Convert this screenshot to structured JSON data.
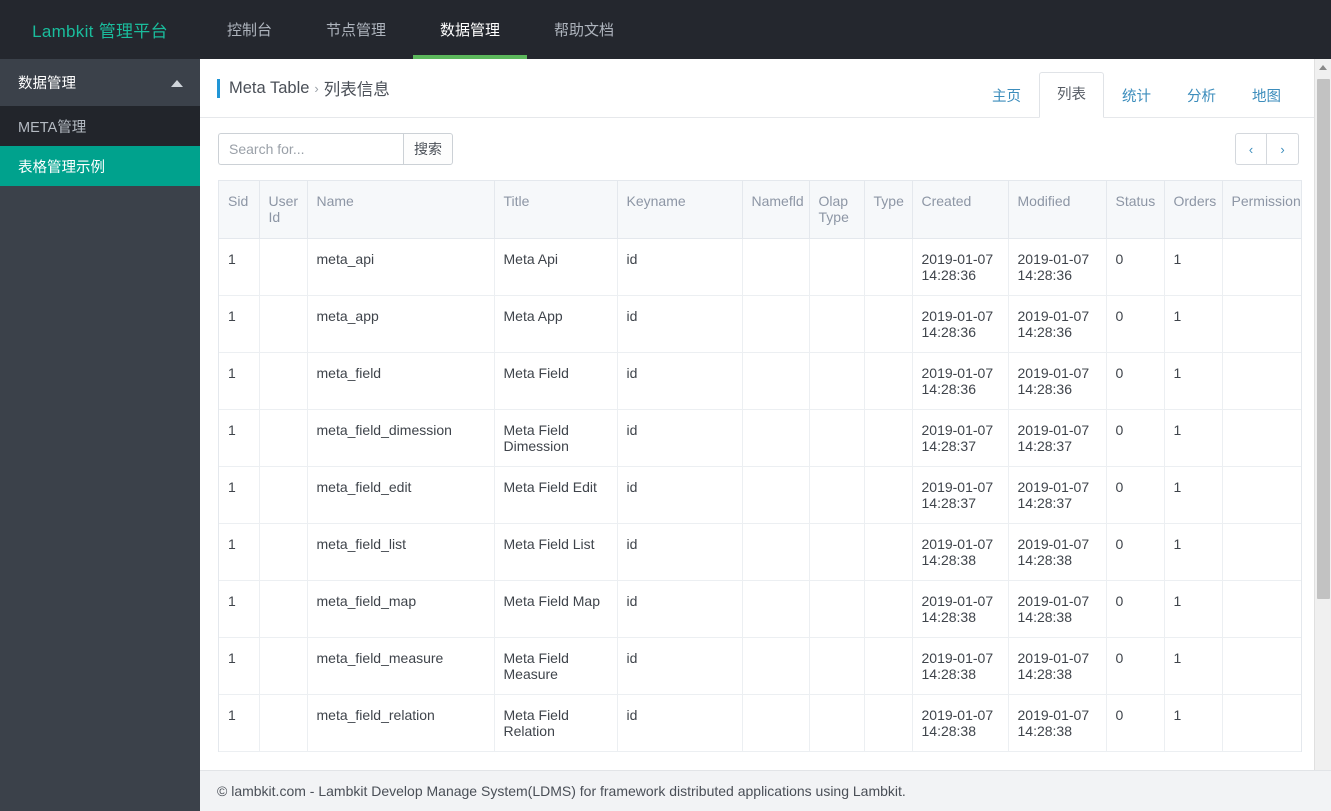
{
  "navbar": {
    "brand": "Lambkit 管理平台",
    "items": [
      {
        "label": "控制台",
        "active": false
      },
      {
        "label": "节点管理",
        "active": false
      },
      {
        "label": "数据管理",
        "active": true
      },
      {
        "label": "帮助文档",
        "active": false
      }
    ],
    "colors": {
      "background": "#24272e",
      "brand": "#1abc9c",
      "active_underline": "#5cb85c"
    }
  },
  "sidebar": {
    "header": "数据管理",
    "items": [
      {
        "label": "META管理",
        "active": false
      },
      {
        "label": "表格管理示例",
        "active": true
      }
    ],
    "colors": {
      "background": "#3b414a",
      "sub_background": "#22252b",
      "active": "#00a28d"
    }
  },
  "page": {
    "breadcrumb_root": "Meta Table",
    "breadcrumb_sep": "›",
    "breadcrumb_current": "列表信息",
    "accent": "#2196d6"
  },
  "tabs": [
    {
      "label": "主页",
      "active": false
    },
    {
      "label": "列表",
      "active": true
    },
    {
      "label": "统计",
      "active": false
    },
    {
      "label": "分析",
      "active": false
    },
    {
      "label": "地图",
      "active": false
    }
  ],
  "toolbar": {
    "search_placeholder": "Search for...",
    "search_value": "",
    "search_button": "搜索",
    "prev_label": "‹",
    "next_label": "›"
  },
  "table": {
    "columns": [
      "Sid",
      "User Id",
      "Name",
      "Title",
      "Keyname",
      "Namefld",
      "Olap Type",
      "Type",
      "Created",
      "Modified",
      "Status",
      "Orders",
      "Permission"
    ],
    "rows": [
      {
        "sid": "1",
        "user_id": "",
        "name": "meta_api",
        "title": "Meta Api",
        "keyname": "id",
        "namefld": "",
        "olap_type": "",
        "type": "",
        "created_date": "2019-01-07",
        "created_time": "14:28:36",
        "modified_date": "2019-01-07",
        "modified_time": "14:28:36",
        "status": "0",
        "orders": "1",
        "permission": ""
      },
      {
        "sid": "1",
        "user_id": "",
        "name": "meta_app",
        "title": "Meta App",
        "keyname": "id",
        "namefld": "",
        "olap_type": "",
        "type": "",
        "created_date": "2019-01-07",
        "created_time": "14:28:36",
        "modified_date": "2019-01-07",
        "modified_time": "14:28:36",
        "status": "0",
        "orders": "1",
        "permission": ""
      },
      {
        "sid": "1",
        "user_id": "",
        "name": "meta_field",
        "title": "Meta Field",
        "keyname": "id",
        "namefld": "",
        "olap_type": "",
        "type": "",
        "created_date": "2019-01-07",
        "created_time": "14:28:36",
        "modified_date": "2019-01-07",
        "modified_time": "14:28:36",
        "status": "0",
        "orders": "1",
        "permission": ""
      },
      {
        "sid": "1",
        "user_id": "",
        "name": "meta_field_dimession",
        "title": "Meta Field Dimession",
        "keyname": "id",
        "namefld": "",
        "olap_type": "",
        "type": "",
        "created_date": "2019-01-07",
        "created_time": "14:28:37",
        "modified_date": "2019-01-07",
        "modified_time": "14:28:37",
        "status": "0",
        "orders": "1",
        "permission": ""
      },
      {
        "sid": "1",
        "user_id": "",
        "name": "meta_field_edit",
        "title": "Meta Field Edit",
        "keyname": "id",
        "namefld": "",
        "olap_type": "",
        "type": "",
        "created_date": "2019-01-07",
        "created_time": "14:28:37",
        "modified_date": "2019-01-07",
        "modified_time": "14:28:37",
        "status": "0",
        "orders": "1",
        "permission": ""
      },
      {
        "sid": "1",
        "user_id": "",
        "name": "meta_field_list",
        "title": "Meta Field List",
        "keyname": "id",
        "namefld": "",
        "olap_type": "",
        "type": "",
        "created_date": "2019-01-07",
        "created_time": "14:28:38",
        "modified_date": "2019-01-07",
        "modified_time": "14:28:38",
        "status": "0",
        "orders": "1",
        "permission": ""
      },
      {
        "sid": "1",
        "user_id": "",
        "name": "meta_field_map",
        "title": "Meta Field Map",
        "keyname": "id",
        "namefld": "",
        "olap_type": "",
        "type": "",
        "created_date": "2019-01-07",
        "created_time": "14:28:38",
        "modified_date": "2019-01-07",
        "modified_time": "14:28:38",
        "status": "0",
        "orders": "1",
        "permission": ""
      },
      {
        "sid": "1",
        "user_id": "",
        "name": "meta_field_measure",
        "title": "Meta Field Measure",
        "keyname": "id",
        "namefld": "",
        "olap_type": "",
        "type": "",
        "created_date": "2019-01-07",
        "created_time": "14:28:38",
        "modified_date": "2019-01-07",
        "modified_time": "14:28:38",
        "status": "0",
        "orders": "1",
        "permission": ""
      },
      {
        "sid": "1",
        "user_id": "",
        "name": "meta_field_relation",
        "title": "Meta Field Relation",
        "keyname": "id",
        "namefld": "",
        "olap_type": "",
        "type": "",
        "created_date": "2019-01-07",
        "created_time": "14:28:38",
        "modified_date": "2019-01-07",
        "modified_time": "14:28:38",
        "status": "0",
        "orders": "1",
        "permission": ""
      }
    ]
  },
  "footer": {
    "text": "© lambkit.com - Lambkit Develop Manage System(LDMS) for framework distributed applications using Lambkit."
  }
}
